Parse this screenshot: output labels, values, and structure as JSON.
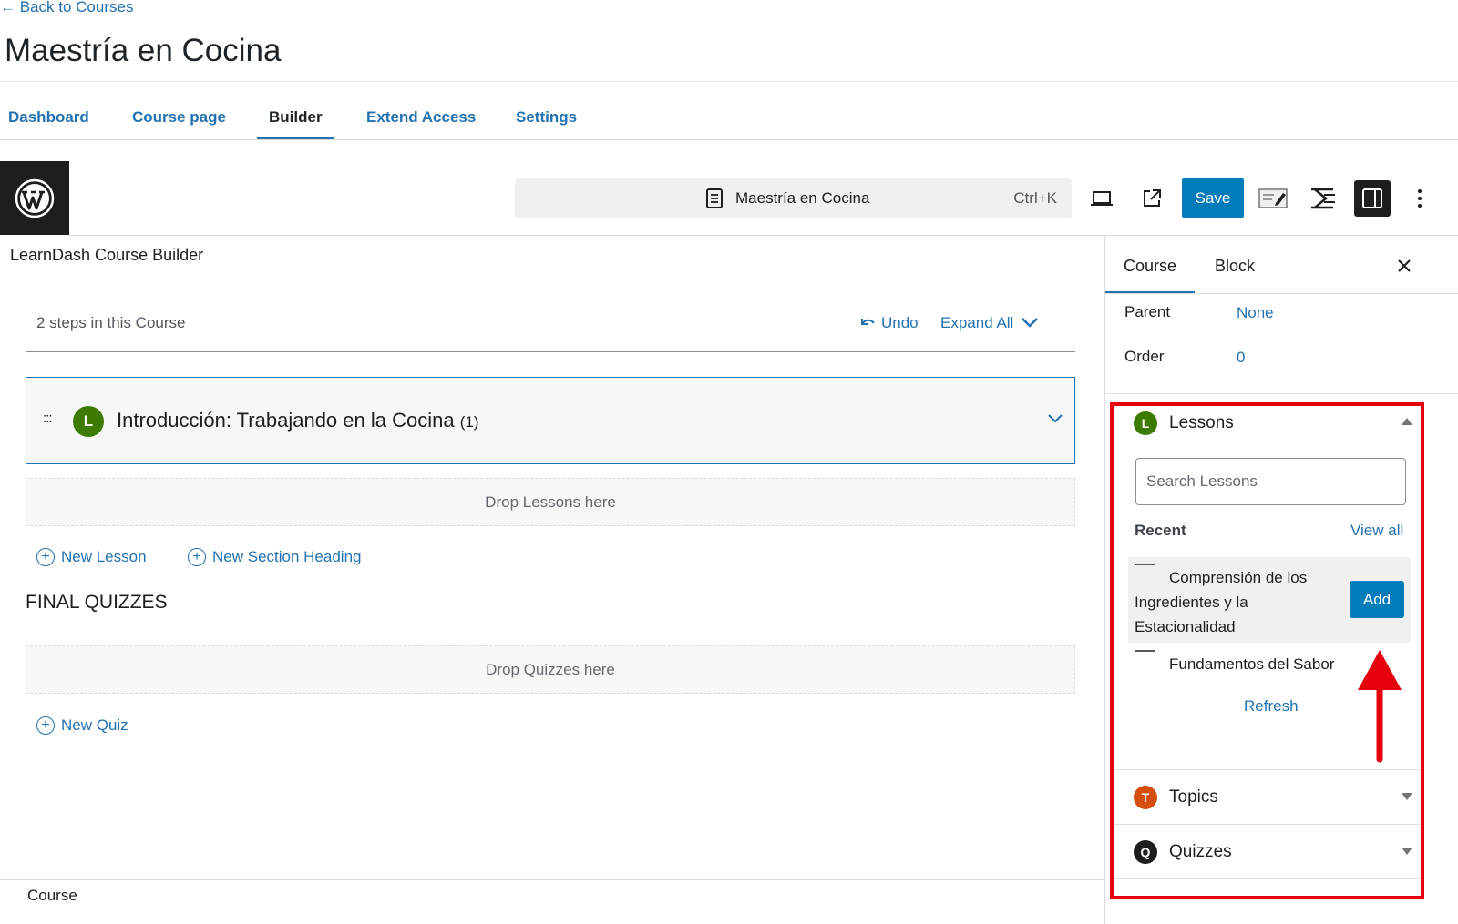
{
  "header": {
    "back_link": "← Back to Courses",
    "title": "Maestría en Cocina"
  },
  "tabs": [
    {
      "label": "Dashboard"
    },
    {
      "label": "Course page"
    },
    {
      "label": "Builder"
    },
    {
      "label": "Extend Access"
    },
    {
      "label": "Settings"
    }
  ],
  "toolbar": {
    "command_title": "Maestría en Cocina",
    "shortcut": "Ctrl+K",
    "save_label": "Save"
  },
  "builder": {
    "title": "LearnDash Course Builder",
    "steps_text": "2 steps in this Course",
    "undo_label": "Undo",
    "expand_label": "Expand All",
    "lesson": {
      "badge": "L",
      "title": "Introducción: Trabajando en la Cocina",
      "count": "(1)"
    },
    "drop_lessons": "Drop Lessons here",
    "new_lesson": "New Lesson",
    "new_section": "New Section Heading",
    "final_quizzes": "FINAL QUIZZES",
    "drop_quizzes": "Drop Quizzes here",
    "new_quiz": "New Quiz"
  },
  "footer": {
    "label": "Course"
  },
  "sidebar": {
    "tab_course": "Course",
    "tab_block": "Block",
    "parent_label": "Parent",
    "parent_value": "None",
    "order_label": "Order",
    "order_value": "0",
    "lessons_panel": {
      "badge": "L",
      "title": "Lessons",
      "search_placeholder": "Search Lessons",
      "recent_label": "Recent",
      "view_all": "View all",
      "items": [
        {
          "title": "Comprensión de los Ingredientes y la Estacionalidad"
        },
        {
          "title": "Fundamentos del Sabor"
        }
      ],
      "add_label": "Add",
      "refresh_label": "Refresh"
    },
    "topics_panel": {
      "badge": "T",
      "title": "Topics"
    },
    "quizzes_panel": {
      "badge": "Q",
      "title": "Quizzes"
    }
  },
  "colors": {
    "accent": "#2271b1",
    "save_button": "#007cba",
    "lesson_badge": "#3c7a00",
    "topic_badge": "#d54e0c",
    "quiz_badge": "#1e1e1e",
    "highlight": "#e5000b"
  },
  "icons": {
    "wp_logo": "wordpress-logo-icon",
    "command_doc": "document-icon",
    "preview": "desktop-preview-icon",
    "external": "external-link-icon",
    "edit_mode": "edit-mode-icon",
    "tools": "learndash-tools-icon",
    "sidebar_toggle": "sidebar-toggle-icon",
    "more": "more-vertical-icon",
    "undo": "undo-icon",
    "expand": "chevron-down-icon",
    "close": "close-icon",
    "annotation_arrow": "red-arrow-up-icon"
  }
}
